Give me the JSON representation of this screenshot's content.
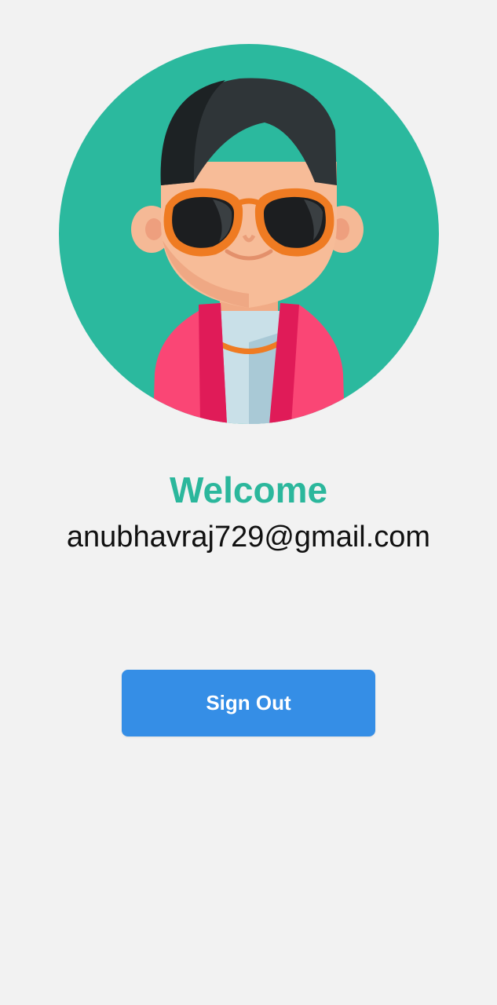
{
  "profile": {
    "avatar_icon": "user-avatar-sunglasses-icon",
    "welcome_title": "Welcome",
    "email": "anubhavraj729@gmail.com"
  },
  "actions": {
    "sign_out_label": "Sign Out"
  },
  "colors": {
    "background": "#f2f2f2",
    "accent_green": "#2bb79c",
    "button_blue": "#358ee6",
    "text_dark": "#111111"
  }
}
